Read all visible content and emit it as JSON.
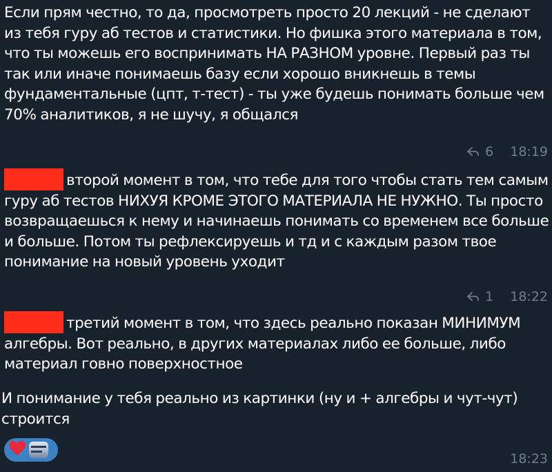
{
  "messages": [
    {
      "text": "Если прям честно, то да, просмотреть просто 20 лекций - не сделают из тебя гуру аб тестов и статистики. Но фишка этого материала в том, что ты можешь его воспринимать НА РАЗНОМ уровне. Первый раз ты так или иначе понимаешь базу если хорошо вникнешь в темы фундаментальные (цпт, т-тест) - ты уже будешь понимать больше чем 70% аналитиков, я не шучу, я общался",
      "replies": "6",
      "time": "18:19"
    },
    {
      "text": "второй момент в том, что тебе для того чтобы стать тем самым гуру аб тестов НИХУЯ КРОМЕ ЭТОГО МАТЕРИАЛА НЕ НУЖНО. Ты просто возвращаешься к нему и начинаешь понимать со временем все больше и больше. Потом ты рефлексируешь и тд и с каждым разом твое понимание на новый уровень уходит",
      "replies": "1",
      "time": "18:22"
    },
    {
      "text": "третий момент в том, что здесь реально показан МИНИМУМ алгебры. Вот реально, в других материалах либо ее больше, либо материал говно поверхностное"
    },
    {
      "text": "И понимание у тебя реально из картинки (ну и + алгебры и чут-чут) строится",
      "time": "18:23"
    }
  ],
  "reaction": {
    "icon": "heart-icon",
    "color": "#e8283b",
    "pill_color": "#3b82c4"
  },
  "colors": {
    "background": "#18222d",
    "meta_text": "#6d7f8f",
    "redaction": "#ff2d1a"
  }
}
